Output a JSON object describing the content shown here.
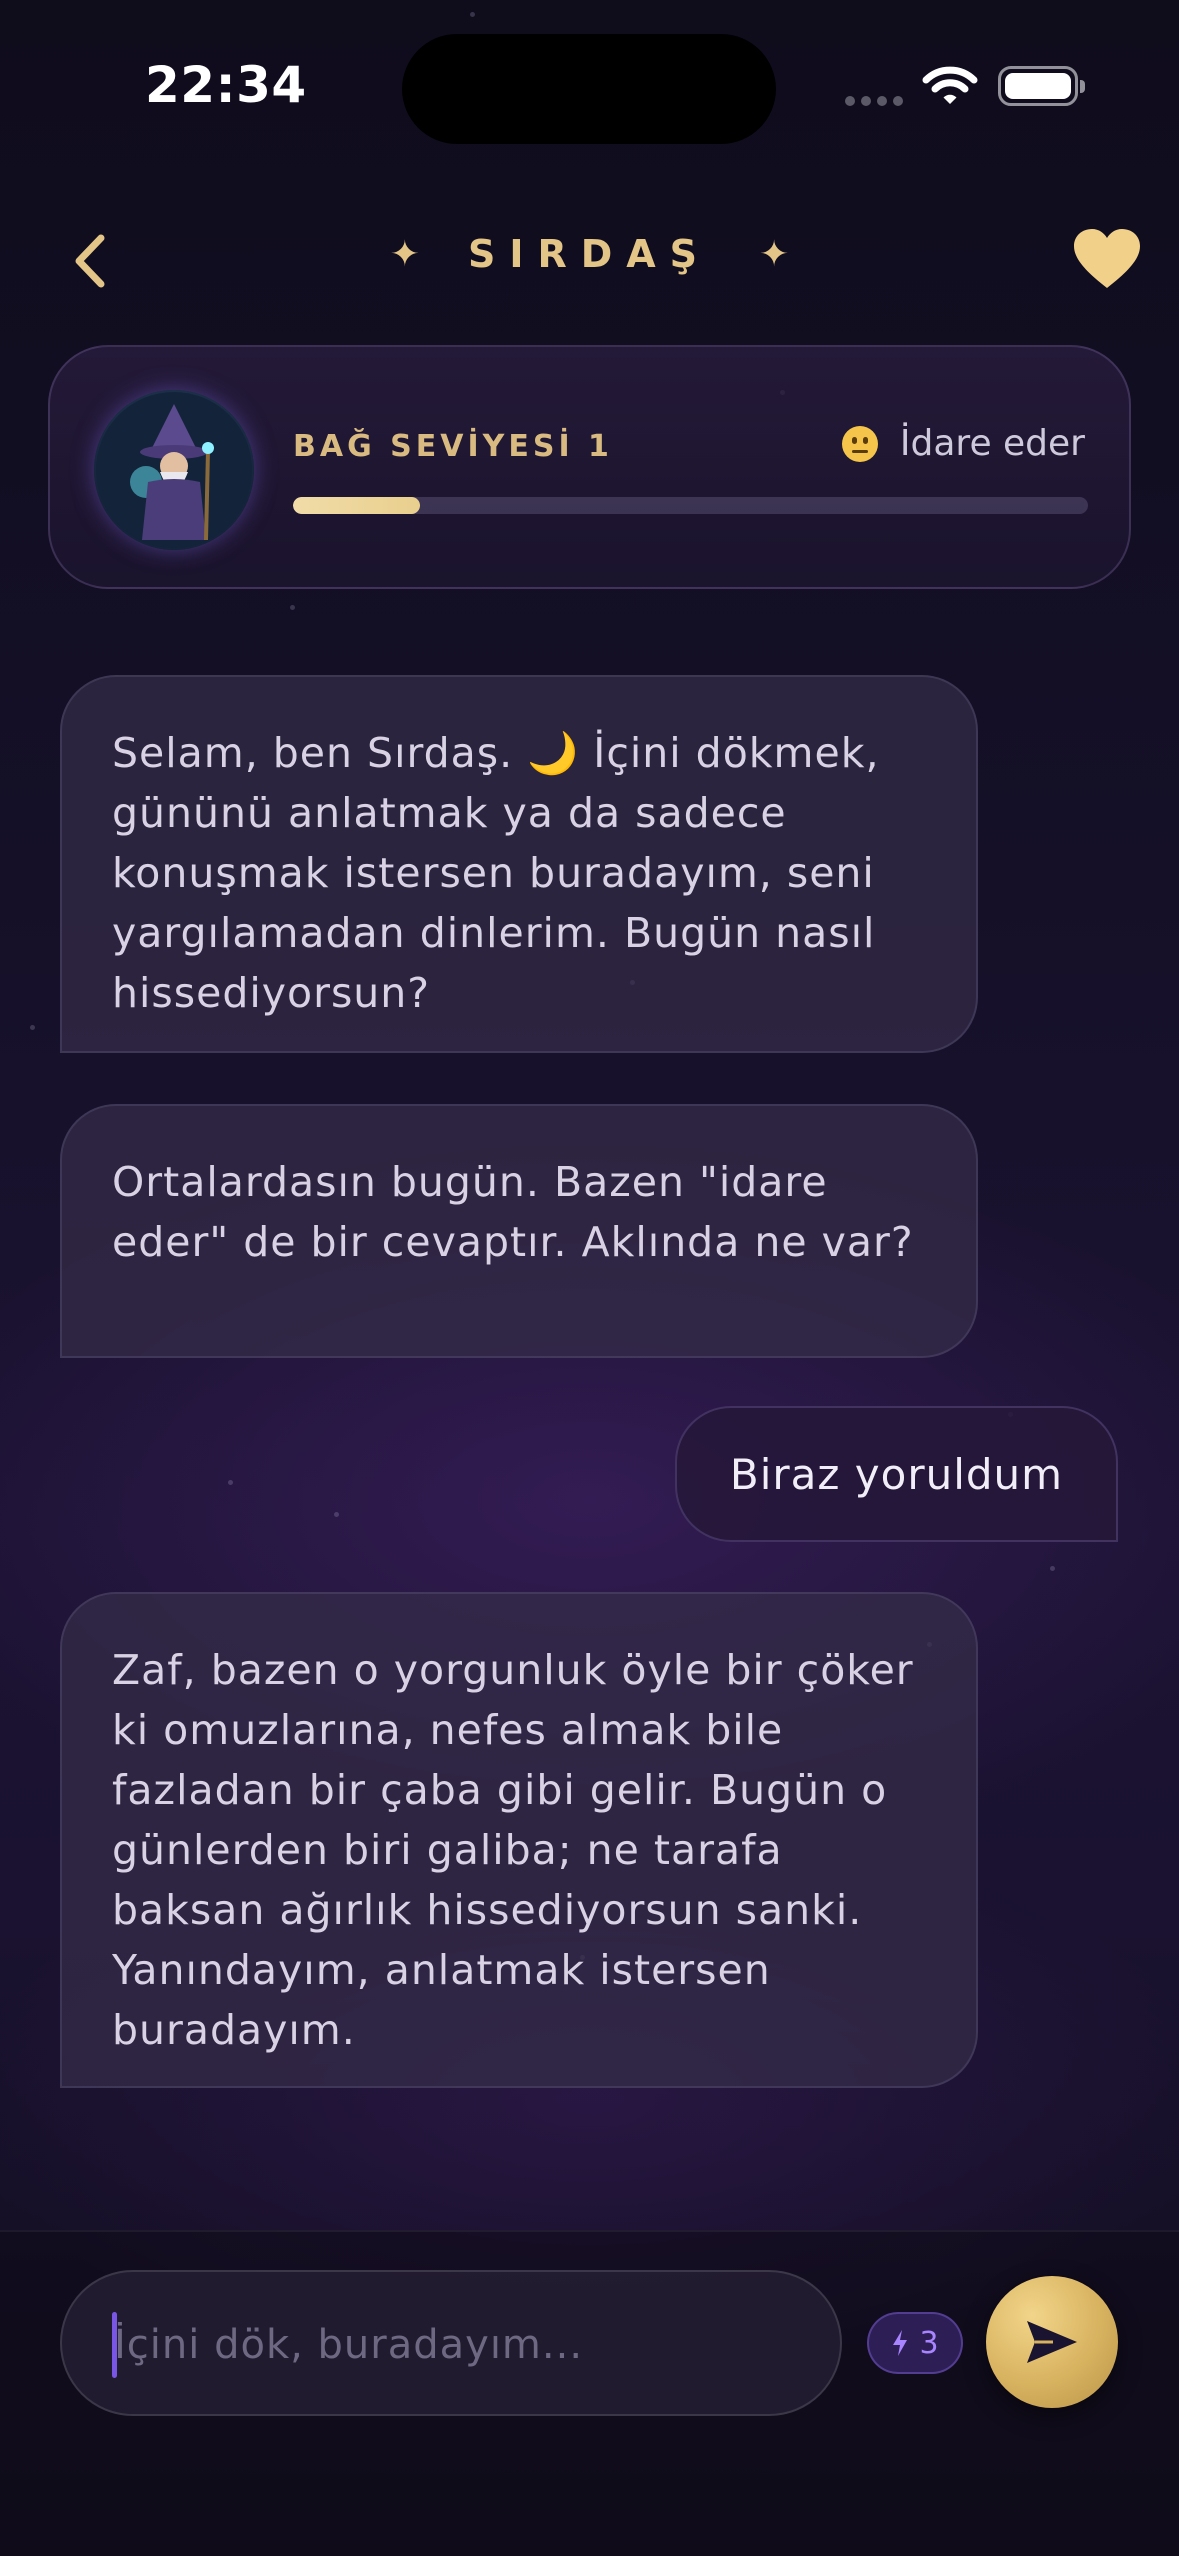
{
  "status_bar": {
    "time": "22:34"
  },
  "header": {
    "title": "SIRDAŞ"
  },
  "bond": {
    "level_label": "BAĞ SEVİYESİ 1",
    "mood_label": "İdare eder",
    "progress_fraction": 0.16
  },
  "messages": [
    {
      "sender": "bot",
      "text": "Selam, ben Sırdaş. 🌙 İçini dökmek, gününü anlatmak ya da sadece konuşmak istersen buradayım, seni yargılamadan dinlerim. Bugün nasıl hissediyorsun?"
    },
    {
      "sender": "bot",
      "text": "Ortalardasın bugün. Bazen \"idare eder\" de bir cevaptır. Aklında ne var?"
    },
    {
      "sender": "user",
      "text": "Biraz yoruldum"
    },
    {
      "sender": "bot",
      "text": "Zaf, bazen o yorgunluk öyle bir çöker ki omuzlarına, nefes almak bile fazladan bir çaba gibi gelir. Bugün o günlerden biri galiba; ne tarafa baksan ağırlık hissediyorsun sanki. Yanındayım, anlatmak istersen buradayım."
    }
  ],
  "composer": {
    "placeholder": "İçini dök, buradayım...",
    "value": "",
    "credits": "3"
  },
  "colors": {
    "accent_gold": "#e3c587",
    "accent_purple": "#7a56e6",
    "background": "#151028"
  },
  "icons": [
    "back-chevron-icon",
    "sparkle-icon",
    "heart-icon",
    "mood-neutral-emoji-icon",
    "lightning-icon",
    "send-icon",
    "wifi-icon",
    "battery-icon"
  ]
}
